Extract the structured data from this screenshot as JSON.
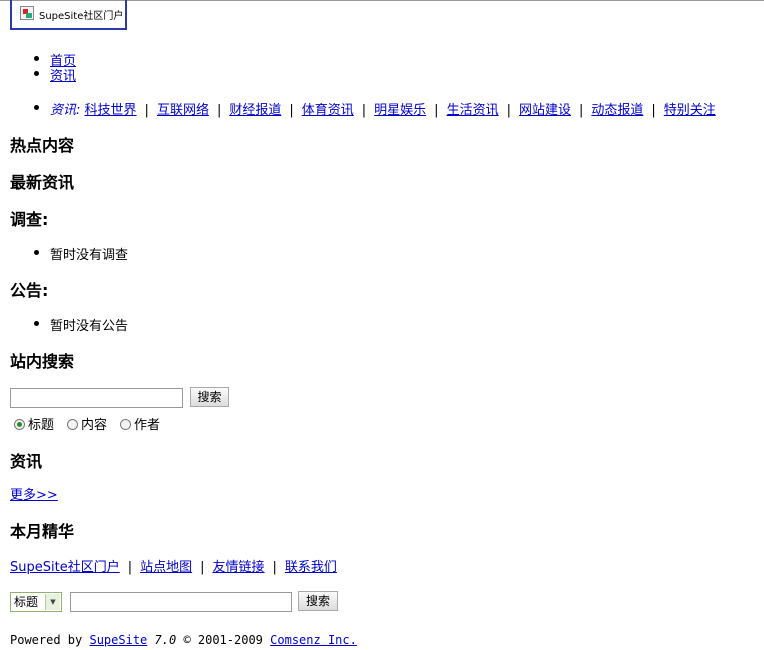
{
  "logo": {
    "text": "SupeSite社区门户"
  },
  "nav": [
    "首页",
    "资讯"
  ],
  "subnav": {
    "caption": "资讯:",
    "items": [
      "科技世界",
      "互联网络",
      "财经报道",
      "体育资讯",
      "明星娱乐",
      "生活资讯",
      "网站建设",
      "动态报道",
      "特别关注"
    ]
  },
  "sections": {
    "hot": "热点内容",
    "latest": "最新资讯",
    "poll": "调查:",
    "poll_empty": "暂时没有调查",
    "notice": "公告:",
    "notice_empty": "暂时没有公告",
    "search": "站内搜索",
    "news": "资讯",
    "more": "更多>>",
    "monthly": "本月精华"
  },
  "search": {
    "value": "",
    "button": "搜索",
    "options": [
      "标题",
      "内容",
      "作者"
    ],
    "selected": "标题"
  },
  "links": [
    "SupeSite社区门户",
    "站点地图",
    "友情链接",
    "联系我们"
  ],
  "bottom_search": {
    "select": "标题",
    "value": "",
    "button": "搜索"
  },
  "footer": {
    "powered": "Powered by",
    "product": "SupeSite",
    "version": "7.0",
    "copy": "© 2001-2009",
    "company": "Comsenz Inc."
  },
  "colors": {
    "link": "#0000cc",
    "logo_border": "#2b3aa8"
  }
}
